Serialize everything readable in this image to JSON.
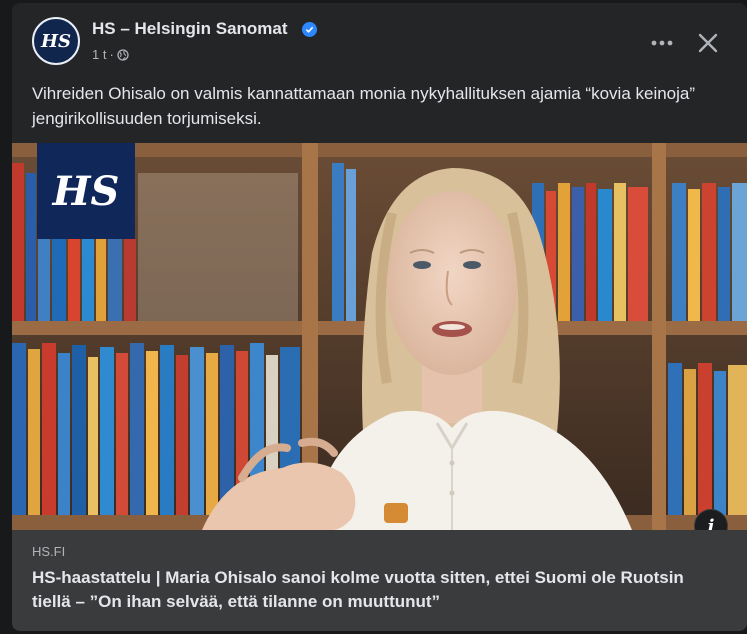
{
  "post": {
    "page_name": "HS – Helsingin Sanomat",
    "avatar_text": "HS",
    "time": "1 t",
    "separator": "·",
    "text": "Vihreiden Ohisalo on valmis kannattamaan monia nykyhallituksen ajamia “kovia keinoja” jengirikollisuuden torjumiseksi.",
    "media": {
      "badge_text": "HS",
      "info_label": "i"
    },
    "link": {
      "domain": "HS.FI",
      "title": "HS-haastattelu | Maria Ohisalo sanoi kolme vuotta sitten, ettei Suomi ole Ruotsin tiellä – ”On ihan selvää, että tilanne on muuttunut”"
    },
    "icons": {
      "verified": "verified-badge-icon",
      "audience": "globe-icon",
      "more": "more-options-icon",
      "close": "close-icon"
    }
  },
  "colors": {
    "background": "#18191a",
    "card": "#242526",
    "link_box": "#3a3b3c",
    "verified": "#2d88ff",
    "hs_brand": "#10275a"
  }
}
